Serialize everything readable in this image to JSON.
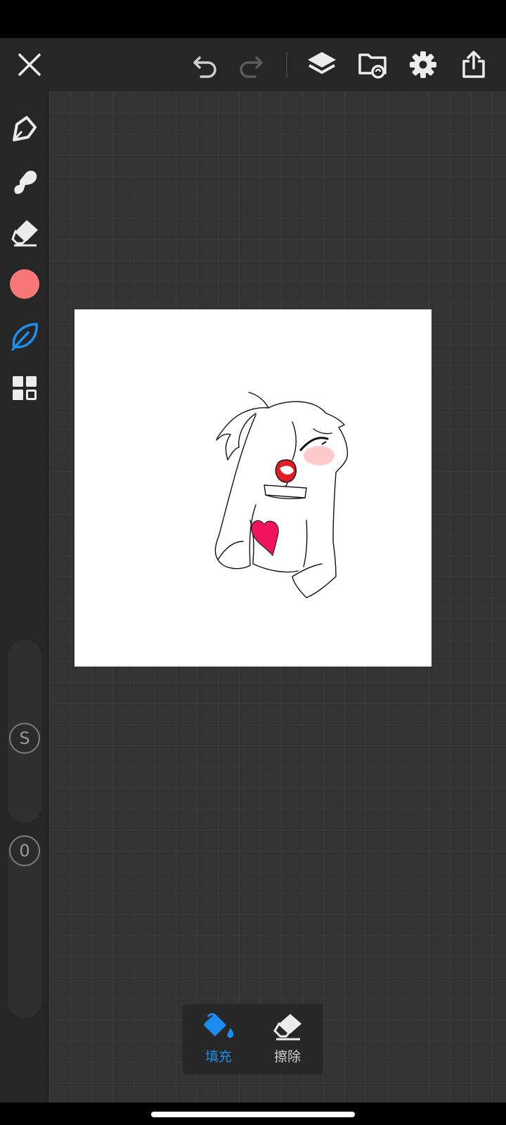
{
  "status_bar": {},
  "toolbar": {
    "icons": [
      "close-icon",
      "undo-icon",
      "redo-icon",
      "layers-icon",
      "gallery-icon",
      "settings-icon",
      "share-icon"
    ]
  },
  "sidebar": {
    "icons": [
      "pen-icon",
      "brush-icon",
      "eraser-icon",
      "color-swatch",
      "leaf-icon",
      "grid-icon"
    ],
    "current_color": "#f87777",
    "active_tool_color": "#1a8ff0",
    "size_slider_label": "S",
    "opacity_slider_label": "0"
  },
  "fill_panel": {
    "fill_label": "填充",
    "erase_label": "擦除",
    "active_color": "#1a8ff0"
  }
}
